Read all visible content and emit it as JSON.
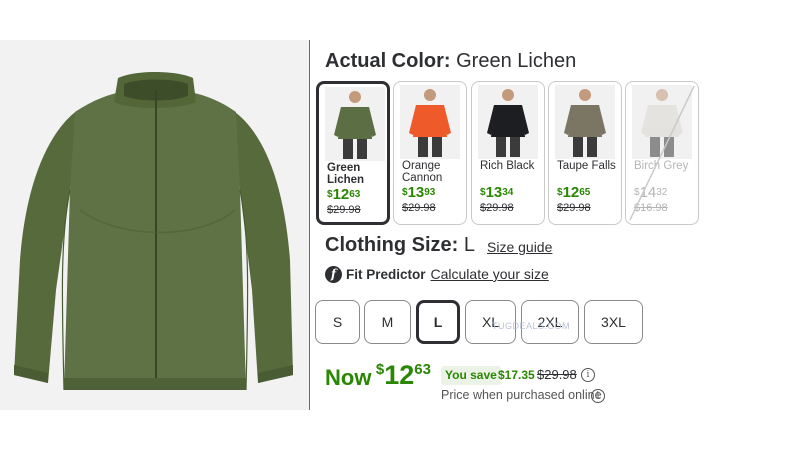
{
  "color_section": {
    "label": "Actual Color:",
    "value": "Green Lichen"
  },
  "swatches": [
    {
      "name": "Green Lichen",
      "currency": "$",
      "dollars": "12",
      "cents": "63",
      "was": "$29.98",
      "state": "selected",
      "jacket_color": "#5c6e44"
    },
    {
      "name": "Orange Cannon",
      "currency": "$",
      "dollars": "13",
      "cents": "93",
      "was": "$29.98",
      "state": "available",
      "jacket_color": "#ee5a2a"
    },
    {
      "name": "Rich Black",
      "currency": "$",
      "dollars": "13",
      "cents": "34",
      "was": "$29.98",
      "state": "available",
      "jacket_color": "#1d1e22"
    },
    {
      "name": "Taupe Falls",
      "currency": "$",
      "dollars": "12",
      "cents": "65",
      "was": "$29.98",
      "state": "available",
      "jacket_color": "#7b7563"
    },
    {
      "name": "Birch Grey",
      "currency": "$",
      "dollars": "14",
      "cents": "32",
      "was": "$16.98",
      "state": "unavailable",
      "jacket_color": "#d9d7d0"
    }
  ],
  "size_section": {
    "label": "Clothing Size:",
    "value": "L",
    "guide_link": "Size guide"
  },
  "fit_predictor": {
    "icon_letter": "f",
    "label": "Fit Predictor",
    "link": "Calculate your size"
  },
  "sizes": [
    {
      "label": "S",
      "selected": false
    },
    {
      "label": "M",
      "selected": false
    },
    {
      "label": "L",
      "selected": true
    },
    {
      "label": "XL",
      "selected": false
    },
    {
      "label": "2XL",
      "selected": false
    },
    {
      "label": "3XL",
      "selected": false
    }
  ],
  "watermark": "TUGDEALS.COM",
  "price": {
    "now_label": "Now",
    "currency": "$",
    "dollars": "12",
    "cents": "63",
    "you_save_label": "You save",
    "save_amount": "$17.35",
    "was": "$29.98",
    "note": "Price when purchased online",
    "info_glyph": "i"
  },
  "colors": {
    "accent_green": "#2a8703",
    "text_dark": "#2e2f32",
    "product_green": "#5c6e44"
  }
}
